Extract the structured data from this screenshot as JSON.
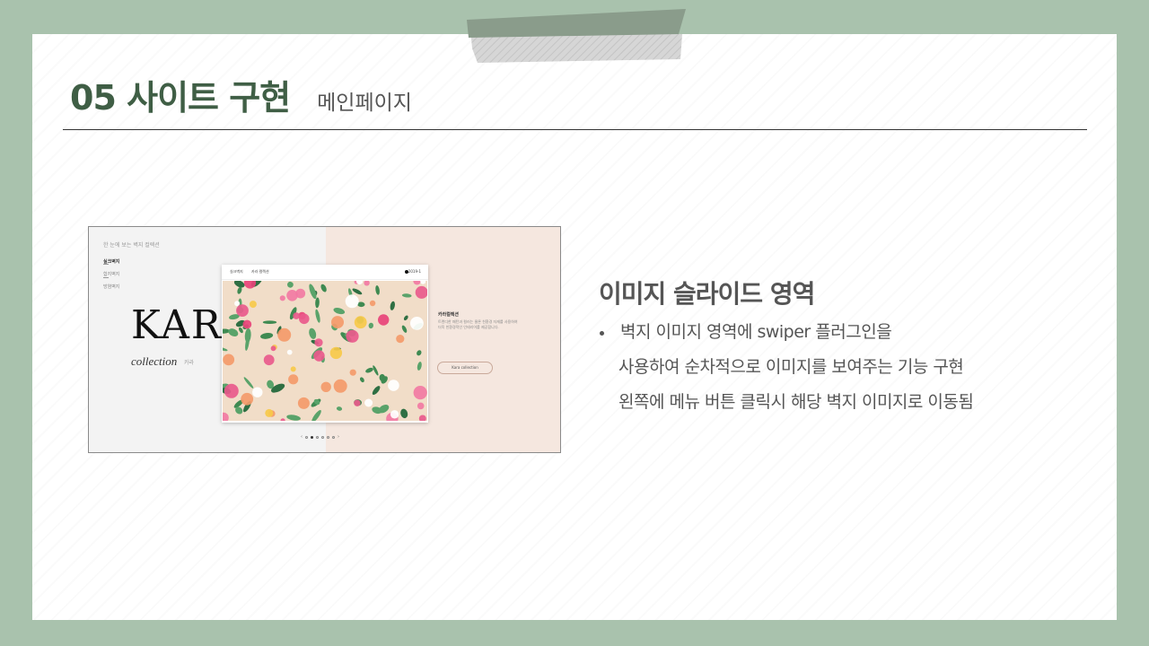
{
  "slide": {
    "title": "05 사이트 구현",
    "subtitle": "메인페이지",
    "colors": {
      "frame": "#a9c2ad",
      "title": "#3f5e45",
      "body_text": "#555555"
    }
  },
  "screenshot": {
    "tagline": "한 눈에 보는 벽지 컬렉션",
    "menu": [
      "실크벽지",
      "합지벽지",
      "방염벽지"
    ],
    "brand": "KARA",
    "brand_sub": "collection",
    "brand_sub_kr": "카라",
    "nav": [
      "실크벽지",
      "카라 컬렉션"
    ],
    "nav_year": "2019-1",
    "side_title": "카라컬렉션",
    "side_text": "트렌디한 패턴과 컬러는 물론 친환경 자재를 사용하여 더욱 친환경적인 인테리어를 제공합니다.",
    "side_button": "Kara collection",
    "pager": {
      "prev": "‹",
      "next": "›",
      "count": 6,
      "active": 1
    }
  },
  "description": {
    "heading": "이미지 슬라이드 영역",
    "lines": [
      "벽지 이미지 영역에 swiper 플러그인을",
      "사용하여 순차적으로 이미지를 보여주는 기능 구현",
      "왼쪽에 메뉴 버튼 클릭시 해당 벽지 이미지로 이동됨"
    ]
  }
}
